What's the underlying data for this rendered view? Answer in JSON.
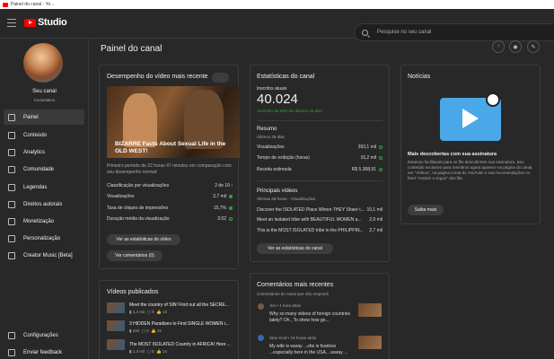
{
  "browser": {
    "tab_title": "Painel do canal - Yo..."
  },
  "topbar": {
    "logo_text": "Studio",
    "search_placeholder": "Pesquise no seu canal"
  },
  "sidebar": {
    "channel_name": "Seu canal",
    "channel_handle": "CuriuNation",
    "items": [
      {
        "label": "Painel",
        "active": true
      },
      {
        "label": "Conteúdo"
      },
      {
        "label": "Analytics"
      },
      {
        "label": "Comunidade"
      },
      {
        "label": "Legendas"
      },
      {
        "label": "Direitos autorais"
      },
      {
        "label": "Monetização"
      },
      {
        "label": "Personalização"
      },
      {
        "label": "Creator Music [Beta]"
      }
    ],
    "bottom_items": [
      {
        "label": "Configurações"
      },
      {
        "label": "Enviar feedback"
      }
    ]
  },
  "main": {
    "title": "Painel do canal"
  },
  "latest_video": {
    "title": "Desempenho do vídeo mais recente",
    "thumb_caption": "BIZARRE Facts About Sexual Life in the OLD WEST!",
    "summary": "Primeiro período de 22 horas 47 minutos em comparação com seu desempenho normal:",
    "metrics": [
      {
        "label": "Classificação por visualizações",
        "value": "2 de 10"
      },
      {
        "label": "Visualizações",
        "value": "2,7 mil"
      },
      {
        "label": "Taxa de cliques de impressões",
        "value": "15,7%"
      },
      {
        "label": "Duração média da visualização",
        "value": "2:02"
      }
    ],
    "btn_stats": "Ver as estatísticas do vídeo",
    "btn_comments": "Ver comentários (0)"
  },
  "published": {
    "title": "Vídeos publicados",
    "videos": [
      {
        "title": "Meet the country of SIN! Find out all the SECRE...",
        "views": "1,4 mil",
        "comments": "0",
        "likes": "13"
      },
      {
        "title": "3 HIDDEN Paradises to Find SINGLE WOMEN i...",
        "views": "234",
        "comments": "0",
        "likes": "21"
      },
      {
        "title": "The MOST ISOLATED Country in AFRICA! Here ...",
        "views": "1,4 mil",
        "comments": "0",
        "likes": "14"
      }
    ]
  },
  "channel_stats": {
    "title": "Estatísticas do canal",
    "subs_label": "Inscritos atuais",
    "subs_value": "40.024",
    "subs_delta": "Aumento de 808 nos últimos 28 dias",
    "summary_title": "Resumo",
    "summary_period": "Últimos 28 dias",
    "summary_rows": [
      {
        "label": "Visualizações",
        "value": "393,1 mil"
      },
      {
        "label": "Tempo de exibição (horas)",
        "value": "16,2 mil"
      },
      {
        "label": "Receita estimada",
        "value": "R$ 5.368,91"
      }
    ],
    "top_title": "Principais vídeos",
    "top_period": "Últimas 48 horas · Visualizações",
    "top_rows": [
      {
        "label": "Discover the ISOLATED Place Where THEY Share t...",
        "value": "10,1 mil"
      },
      {
        "label": "Meet an Isolated tribe with BEAUTIFUL WOMEN a...",
        "value": "2,9 mil"
      },
      {
        "label": "This is the MOST ISOLATED tribe in the PHILIPPIN...",
        "value": "2,7 mil"
      }
    ],
    "btn": "Ver as estatísticas do canal"
  },
  "comments": {
    "title": "Comentários mais recentes",
    "subtitle": "Comentários do canal que não respondi",
    "items": [
      {
        "author": "Jim",
        "time": "1 hora atrás",
        "text": "Why so many videos of foreign countries lately? Oh , To show how go..."
      },
      {
        "author": "Stan Kroll",
        "time": "15 horas atrás",
        "text": "My wife is waray ...she is fearless ...especially here in the USA....waray ..."
      }
    ]
  },
  "news": {
    "title": "Notícias",
    "headline": "Mais descobertas com sua assinatura",
    "body": "Estamos facilitando para os fãs descobrirem sua assinatura. Seu conteúdo exclusivo para membros agora aparece na página do canal, em \"Vídeos\", na página inicial do YouTube e nas recomendações no feed \"Assistir a seguir\" dos fãs.",
    "btn": "Saiba mais"
  }
}
